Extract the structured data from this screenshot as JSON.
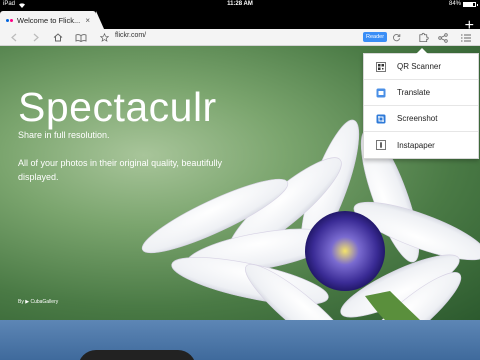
{
  "status": {
    "device": "iPad",
    "time": "11:28 AM",
    "battery": "84%",
    "battery_level": 0.84
  },
  "tab": {
    "title": "Welcome to Flick..."
  },
  "toolbar": {
    "url": "flickr.com/",
    "reader_label": "Reader"
  },
  "hero": {
    "title": "Spectaculr",
    "subtitle": "Share in full resolution.",
    "description": "All of your photos in their original quality, beautifully displayed.",
    "credit": "By ▶ CubaGallery"
  },
  "menu": {
    "items": [
      {
        "label": "QR Scanner",
        "icon": "qr-icon"
      },
      {
        "label": "Translate",
        "icon": "translate-icon"
      },
      {
        "label": "Screenshot",
        "icon": "screenshot-icon"
      },
      {
        "label": "Instapaper",
        "icon": "instapaper-icon"
      }
    ]
  },
  "colors": {
    "accent": "#3a8ef6",
    "toolbar": "#f4f4f4"
  }
}
